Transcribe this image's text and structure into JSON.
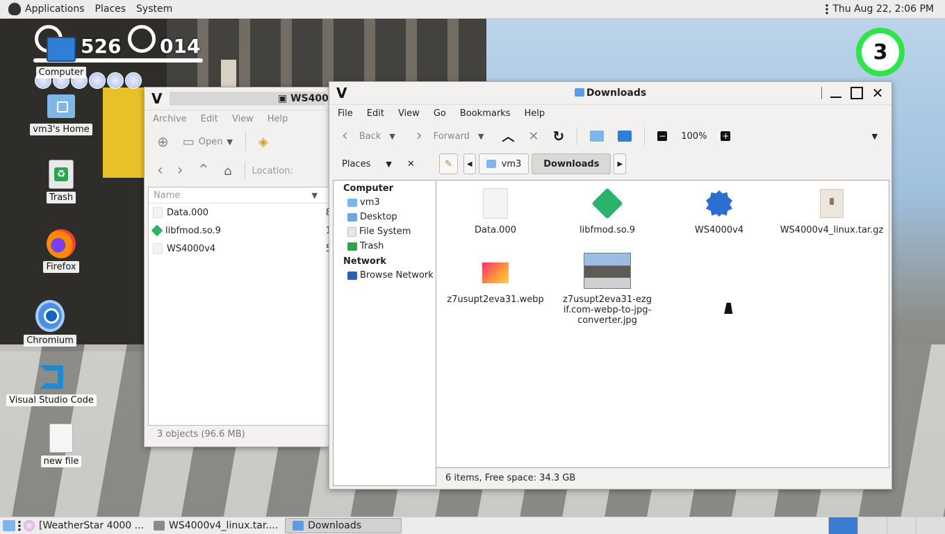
{
  "top_panel": {
    "menus": [
      "Applications",
      "Places",
      "System"
    ],
    "clock": "Thu Aug 22,  2:06 PM"
  },
  "wallpaper_hud": {
    "score1": "526",
    "score2": "014",
    "lives": "3"
  },
  "desktop": {
    "icons": [
      {
        "label": "Computer",
        "icon": "computer-icon"
      },
      {
        "label": "vm3's Home",
        "icon": "home-folder-icon"
      },
      {
        "label": "Trash",
        "icon": "trash-icon"
      },
      {
        "label": "Firefox",
        "icon": "firefox-icon"
      },
      {
        "label": "Chromium",
        "icon": "chromium-icon"
      },
      {
        "label": "Visual Studio Code",
        "icon": "vscode-icon"
      },
      {
        "label": "new file",
        "icon": "file-icon"
      }
    ]
  },
  "archive_window": {
    "title": "WS4000v",
    "menus": [
      "Archive",
      "Edit",
      "View",
      "Help"
    ],
    "toolbar": {
      "open": "Open"
    },
    "location_label": "Location:",
    "column_name": "Name",
    "rows": [
      {
        "name": "Data.000",
        "size": "8"
      },
      {
        "name": "libfmod.so.9",
        "size": "1"
      },
      {
        "name": "WS4000v4",
        "size": "5"
      }
    ],
    "status": "3 objects (96.6 MB)"
  },
  "downloads_window": {
    "title": "Downloads",
    "menus": [
      "File",
      "Edit",
      "View",
      "Go",
      "Bookmarks",
      "Help"
    ],
    "toolbar": {
      "back": "Back",
      "forward": "Forward",
      "zoom": "100%"
    },
    "places_label": "Places",
    "breadcrumbs": [
      "vm3",
      "Downloads"
    ],
    "sidebar": {
      "computer_header": "Computer",
      "computer_items": [
        "vm3",
        "Desktop",
        "File System",
        "Trash"
      ],
      "network_header": "Network",
      "network_items": [
        "Browse Network"
      ]
    },
    "files": [
      {
        "name": "Data.000",
        "icon": "generic-file-icon"
      },
      {
        "name": "libfmod.so.9",
        "icon": "library-icon"
      },
      {
        "name": "WS4000v4",
        "icon": "executable-icon"
      },
      {
        "name": "WS4000v4_linux.tar.gz",
        "icon": "archive-icon"
      },
      {
        "name": "z7usupt2eva31.webp",
        "icon": "image-icon"
      },
      {
        "name": "z7usupt2eva31-ezgif.com-webp-to-jpg-converter.jpg",
        "icon": "image-thumbnail-icon"
      }
    ],
    "status": "6 items, Free space: 34.3 GB"
  },
  "taskbar": {
    "tasks": [
      "[WeatherStar 4000 ...",
      "WS4000v4_linux.tar....",
      "Downloads"
    ]
  },
  "colors": {
    "accent": "#3b7bd0",
    "panel": "#ececec",
    "window": "#f2f1ef"
  }
}
